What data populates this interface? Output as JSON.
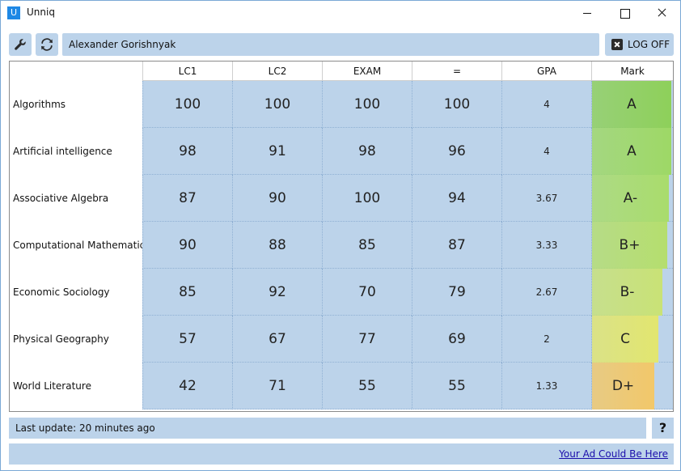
{
  "window": {
    "icon_letter": "U",
    "title": "Unniq"
  },
  "toolbar": {
    "user_name": "Alexander Gorishnyak",
    "logoff_label": "LOG OFF"
  },
  "table": {
    "columns": [
      "LC1",
      "LC2",
      "EXAM",
      "=",
      "GPA",
      "Mark"
    ],
    "rows": [
      {
        "subject": "Algorithms",
        "lc1": "100",
        "lc2": "100",
        "exam": "100",
        "total": "100",
        "gpa": "4",
        "mark": "A",
        "gpa_fraction": 1.0,
        "color": "#8ed05a"
      },
      {
        "subject": "Artificial intelligence",
        "lc1": "98",
        "lc2": "91",
        "exam": "98",
        "total": "96",
        "gpa": "4",
        "mark": "A",
        "gpa_fraction": 1.0,
        "color": "#9ed866"
      },
      {
        "subject": "Associative Algebra",
        "lc1": "87",
        "lc2": "90",
        "exam": "100",
        "total": "94",
        "gpa": "3.67",
        "mark": "A-",
        "gpa_fraction": 0.917,
        "color": "#a9dc6c"
      },
      {
        "subject": "Computational Mathematics",
        "lc1": "90",
        "lc2": "88",
        "exam": "85",
        "total": "87",
        "gpa": "3.33",
        "mark": "B+",
        "gpa_fraction": 0.833,
        "color": "#b5de6e"
      },
      {
        "subject": "Economic Sociology",
        "lc1": "85",
        "lc2": "92",
        "exam": "70",
        "total": "79",
        "gpa": "2.67",
        "mark": "B-",
        "gpa_fraction": 0.667,
        "color": "#c9e276"
      },
      {
        "subject": "Physical Geography",
        "lc1": "57",
        "lc2": "67",
        "exam": "77",
        "total": "69",
        "gpa": "2",
        "mark": "C",
        "gpa_fraction": 0.5,
        "color": "#e2e66f"
      },
      {
        "subject": "World Literature",
        "lc1": "42",
        "lc2": "71",
        "exam": "55",
        "total": "55",
        "gpa": "1.33",
        "mark": "D+",
        "gpa_fraction": 0.333,
        "color": "#f2c86a"
      }
    ]
  },
  "status": {
    "last_update": "Last update: 20 minutes ago",
    "help_label": "?"
  },
  "ad": {
    "link_text": "Your Ad Could Be Here"
  },
  "colors": {
    "cell_bg": "#bcd3ea",
    "accent": "#1e88e5"
  }
}
